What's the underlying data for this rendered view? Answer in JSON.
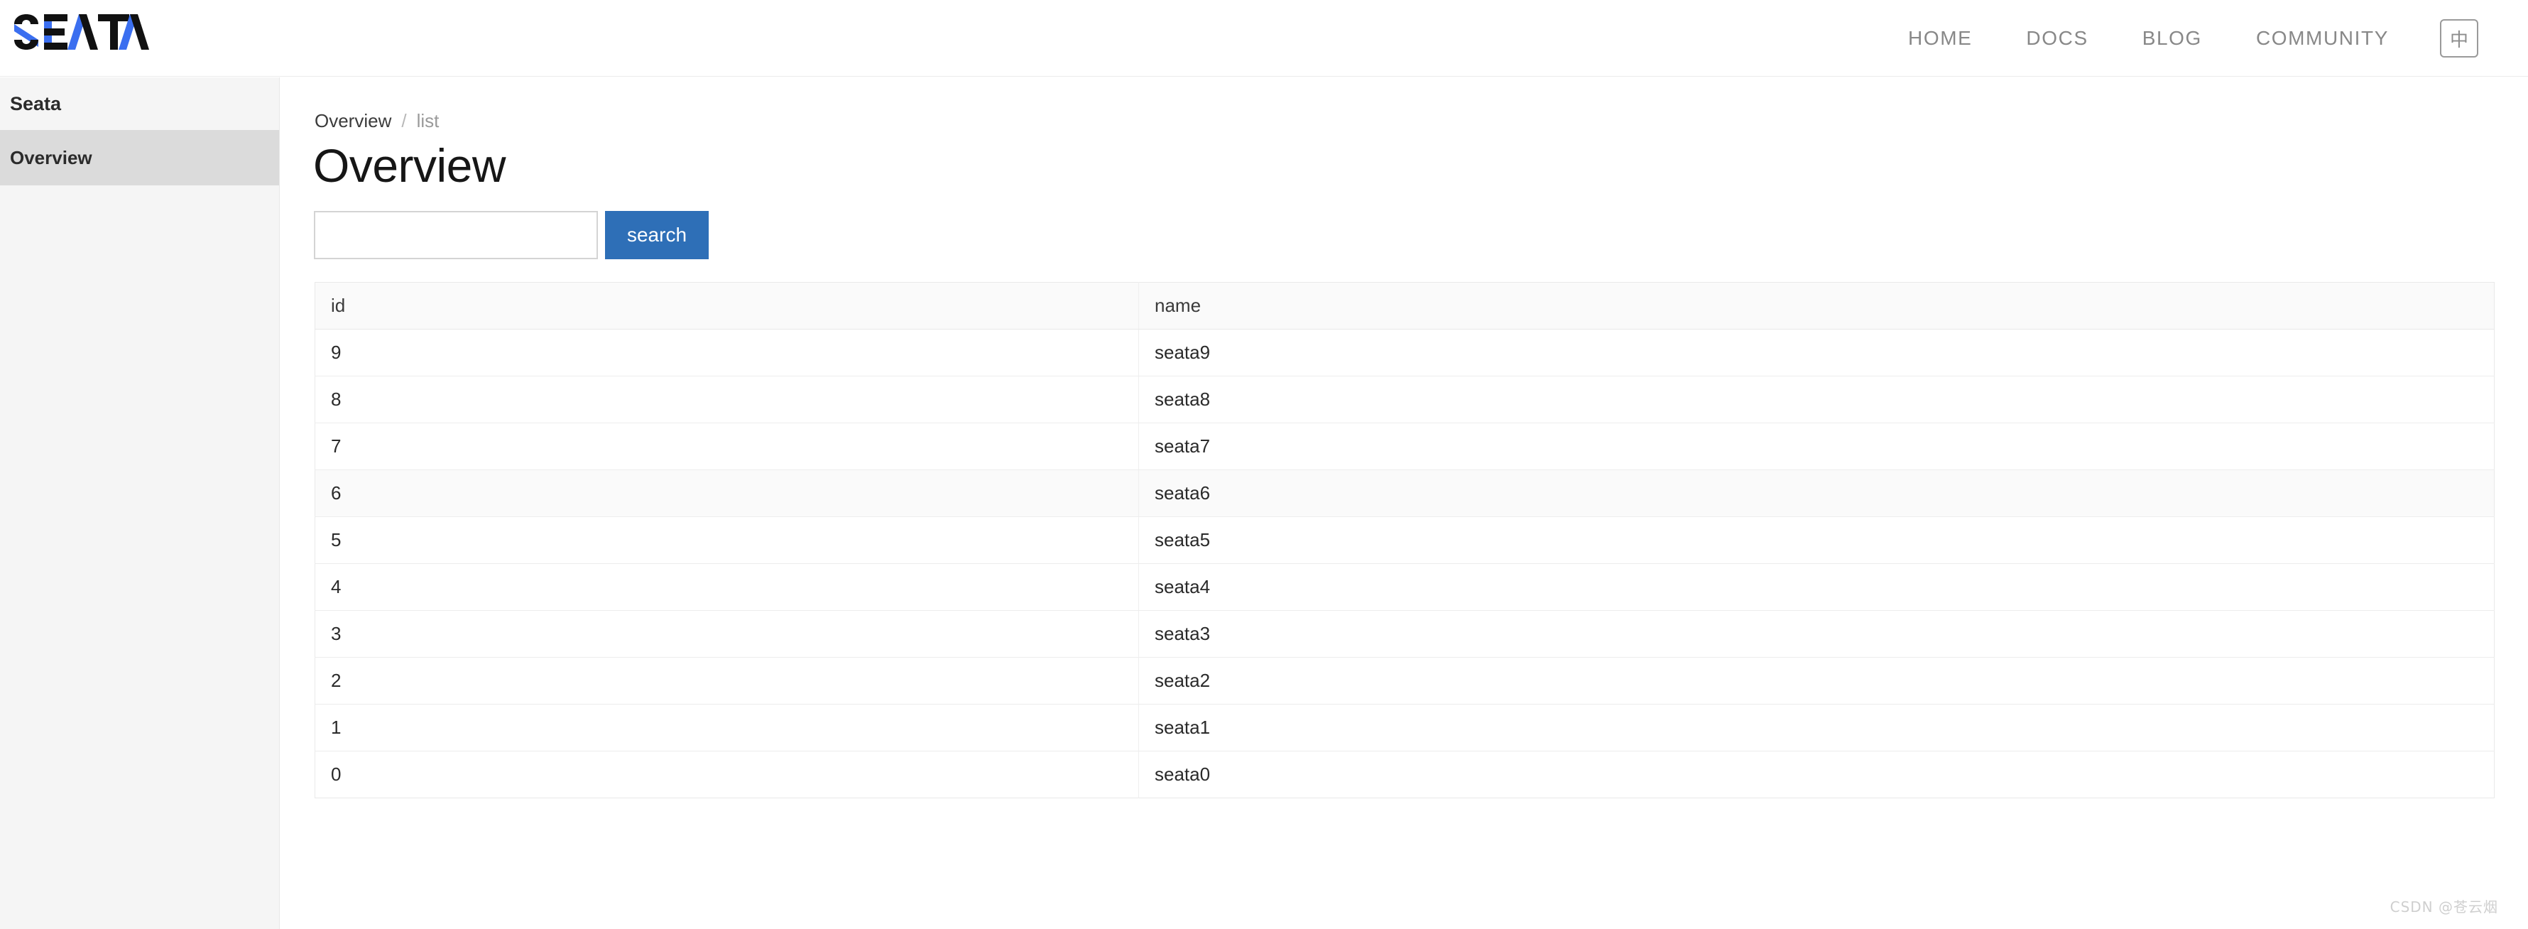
{
  "header": {
    "logo_text": "SEATA",
    "logo_colors": {
      "dark": "#111111",
      "blue": "#3b6ff0"
    },
    "nav": [
      {
        "label": "HOME",
        "name": "nav-home"
      },
      {
        "label": "DOCS",
        "name": "nav-docs"
      },
      {
        "label": "BLOG",
        "name": "nav-blog"
      },
      {
        "label": "COMMUNITY",
        "name": "nav-community"
      }
    ],
    "language_toggle": "中"
  },
  "sidebar": {
    "title": "Seata",
    "items": [
      {
        "label": "Overview",
        "active": true
      }
    ],
    "background": "#f5f5f5",
    "active_background": "#dbdbdb"
  },
  "breadcrumb": {
    "root": "Overview",
    "separator": "/",
    "leaf": "list"
  },
  "main": {
    "page_title": "Overview",
    "search": {
      "value": "",
      "placeholder": "",
      "button_label": "search",
      "button_color": "#2e6fb7"
    },
    "table": {
      "columns": [
        "id",
        "name"
      ],
      "rows": [
        {
          "id": "9",
          "name": "seata9",
          "hover": false
        },
        {
          "id": "8",
          "name": "seata8",
          "hover": false
        },
        {
          "id": "7",
          "name": "seata7",
          "hover": false
        },
        {
          "id": "6",
          "name": "seata6",
          "hover": true
        },
        {
          "id": "5",
          "name": "seata5",
          "hover": false
        },
        {
          "id": "4",
          "name": "seata4",
          "hover": false
        },
        {
          "id": "3",
          "name": "seata3",
          "hover": false
        },
        {
          "id": "2",
          "name": "seata2",
          "hover": false
        },
        {
          "id": "1",
          "name": "seata1",
          "hover": false
        },
        {
          "id": "0",
          "name": "seata0",
          "hover": false
        }
      ]
    }
  },
  "watermark": "CSDN @苍云烟"
}
